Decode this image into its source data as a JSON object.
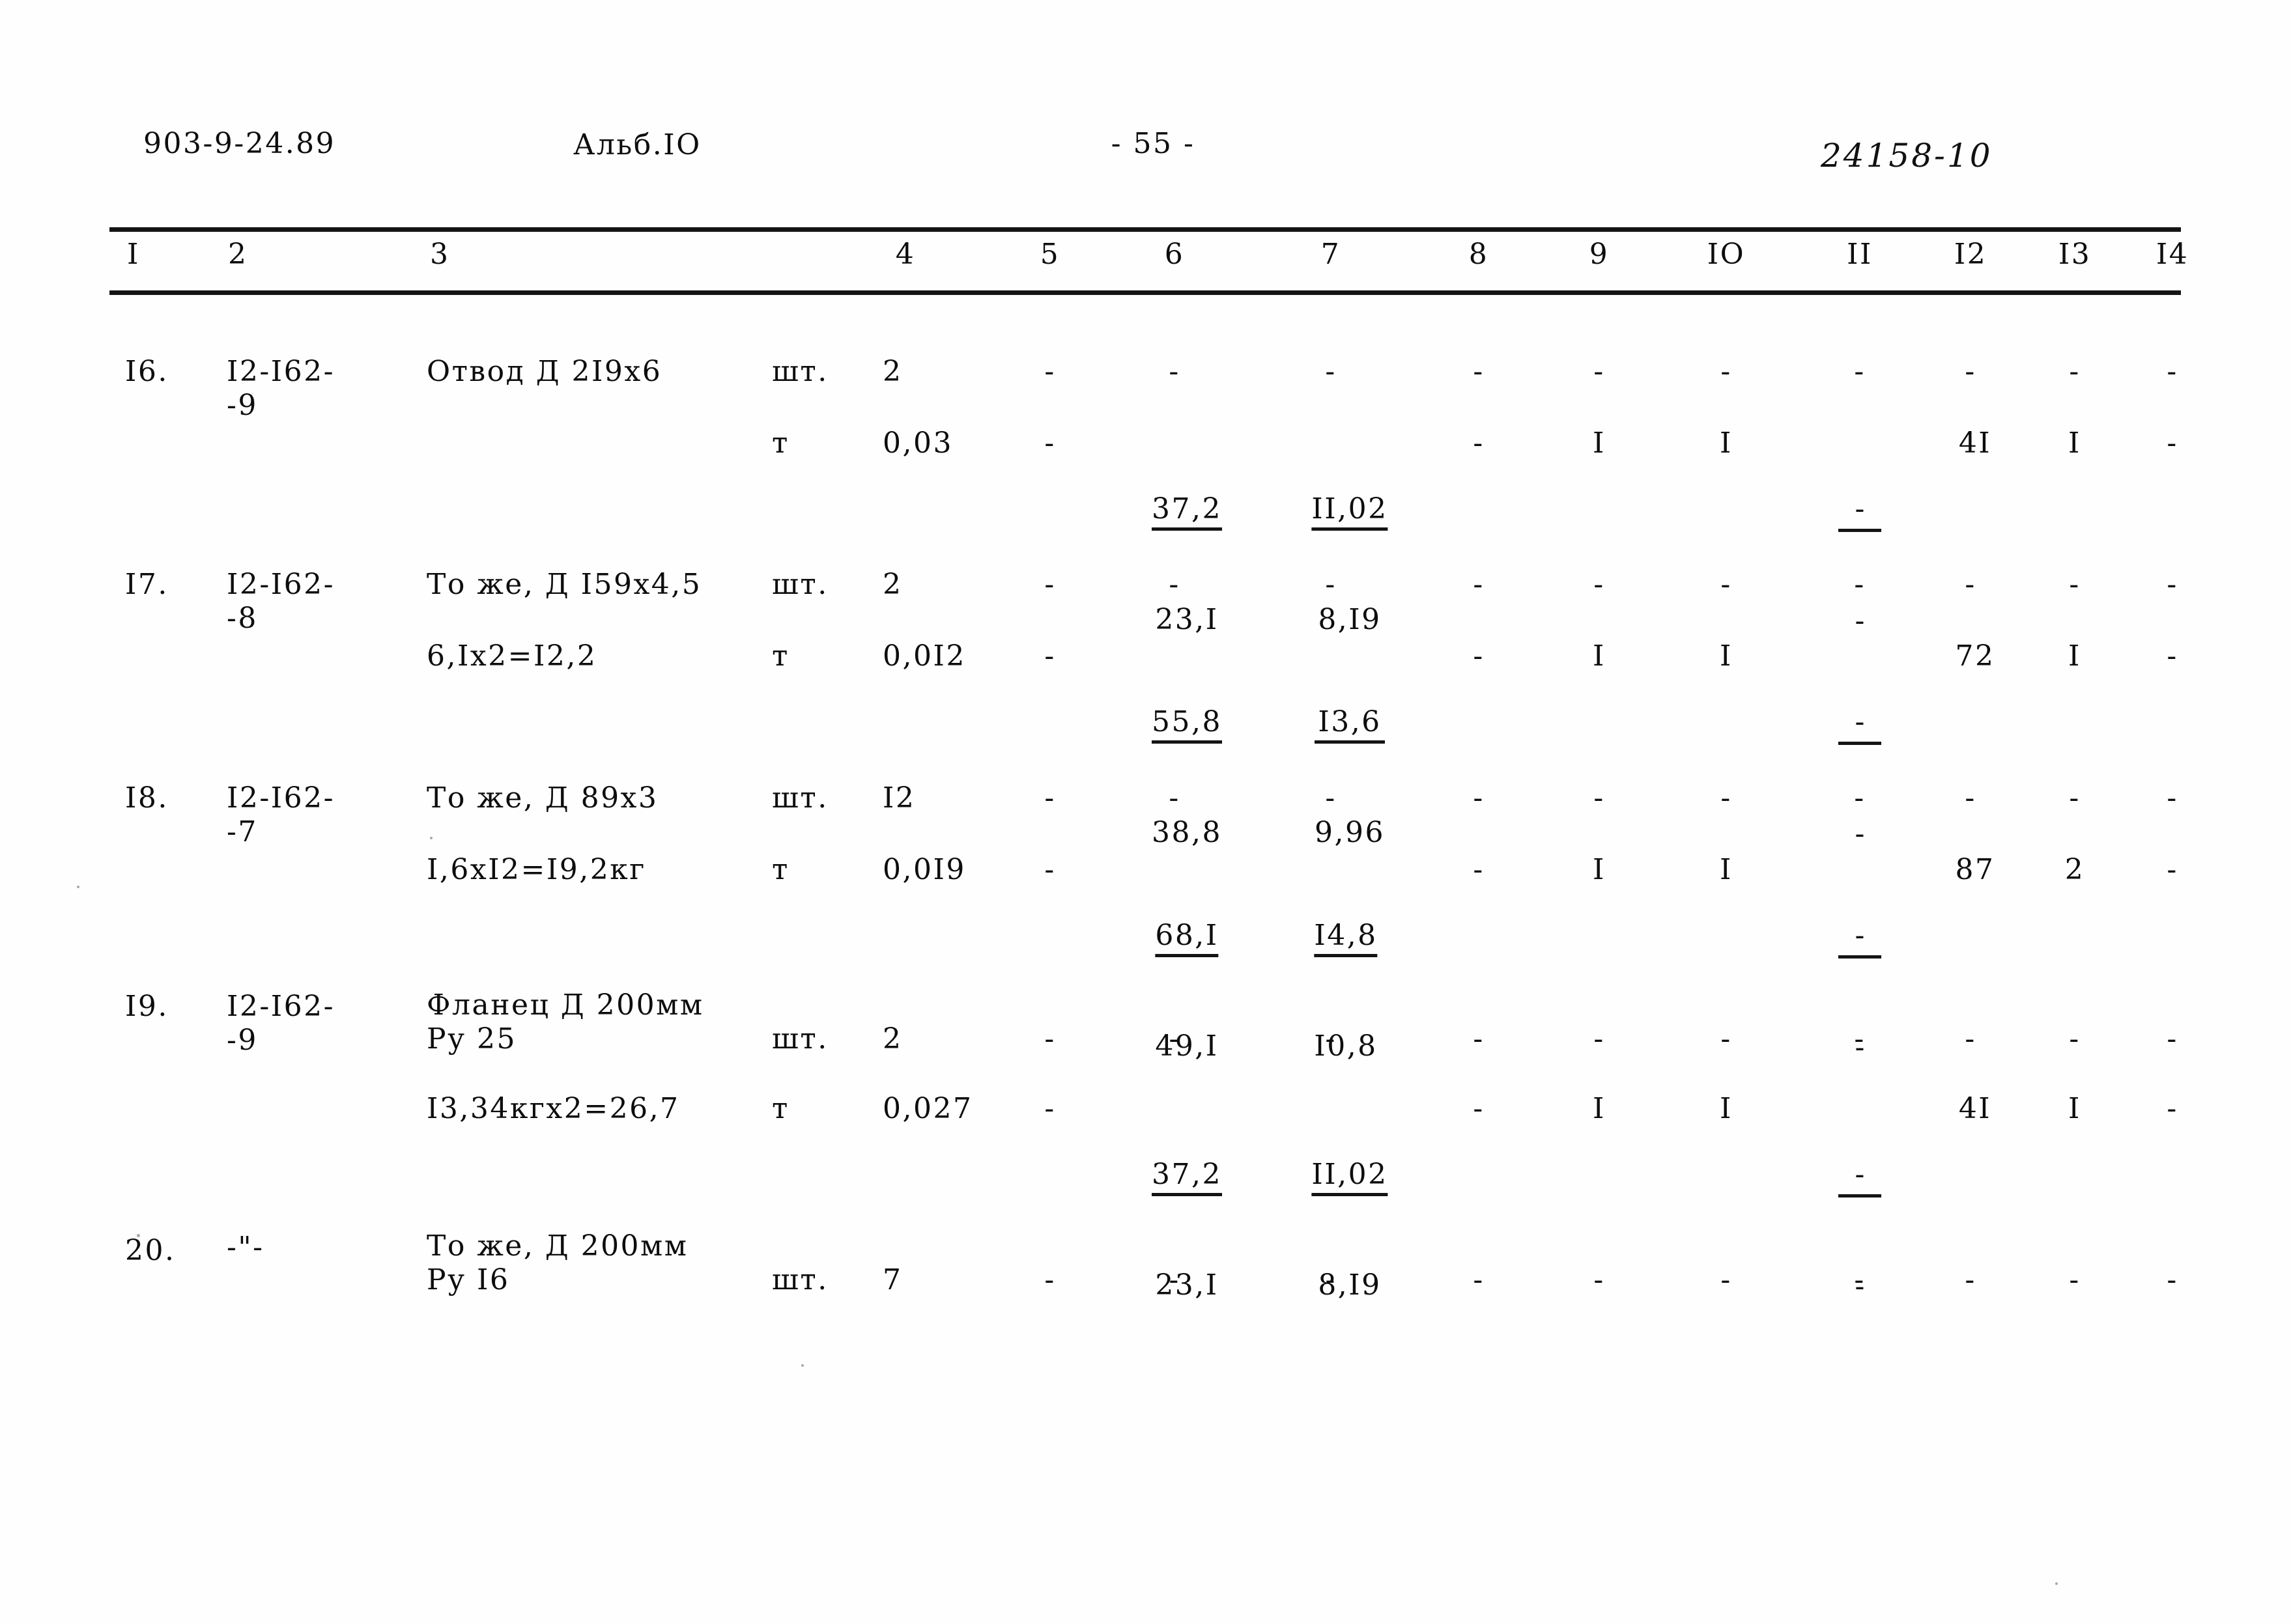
{
  "header": {
    "doc_code": "903-9-24.89",
    "album": "Альб.IO",
    "page_number": "- 55 -",
    "handwritten_mark": "24158-10"
  },
  "table": {
    "column_headers": [
      "I",
      "2",
      "3",
      "4",
      "5",
      "6",
      "7",
      "8",
      "9",
      "IO",
      "II",
      "I2",
      "I3",
      "I4"
    ],
    "rows": [
      {
        "no": "I6.",
        "code_line1": "I2-I62-",
        "code_line2": "-9",
        "name_line1": "Отвод Д 2I9х6",
        "name_line2": "",
        "unit_1": "шт.",
        "unit_2": "т",
        "qty_1": "2",
        "qty_2": "0,03",
        "c5_1": "-",
        "c5_2": "-",
        "c6_1": "-",
        "c6_num": "37,2",
        "c6_den": "23,I",
        "c7_1": "-",
        "c7_num": "II,02",
        "c7_den": "8,I9",
        "c8_1": "-",
        "c8_2": "-",
        "c9_1": "-",
        "c9_2": "I",
        "c10_1": "-",
        "c10_2": "I",
        "c11_1": "-",
        "c11_num": "-",
        "c11_den": "-",
        "c12_1": "-",
        "c12_2": "4I",
        "c13_1": "-",
        "c13_2": "I",
        "c14_1": "-",
        "c14_2": "-"
      },
      {
        "no": "I7.",
        "code_line1": "I2-I62-",
        "code_line2": "-8",
        "name_line1": "То же, Д I59х4,5",
        "name_line2": "6,Iх2=I2,2",
        "unit_1": "шт.",
        "unit_2": "т",
        "qty_1": "2",
        "qty_2": "0,0I2",
        "c5_1": "-",
        "c5_2": "-",
        "c6_1": "-",
        "c6_num": "55,8",
        "c6_den": "38,8",
        "c7_1": "-",
        "c7_num": "I3,6",
        "c7_den": "9,96",
        "c8_1": "-",
        "c8_2": "-",
        "c9_1": "-",
        "c9_2": "I",
        "c10_1": "-",
        "c10_2": "I",
        "c11_1": "-",
        "c11_num": "-",
        "c11_den": "-",
        "c12_1": "-",
        "c12_2": "72",
        "c13_1": "-",
        "c13_2": "I",
        "c14_1": "-",
        "c14_2": "-"
      },
      {
        "no": "I8.",
        "code_line1": "I2-I62-",
        "code_line2": "-7",
        "name_line1": "То же, Д 89х3",
        "name_line2": "I,6хI2=I9,2кг",
        "unit_1": "шт.",
        "unit_2": "т",
        "qty_1": "I2",
        "qty_2": "0,0I9",
        "c5_1": "-",
        "c5_2": "-",
        "c6_1": "-",
        "c6_num": "68,I",
        "c6_den": "49,I",
        "c7_1": "-",
        "c7_num": "I4,8",
        "c7_den": "I0,8",
        "c8_1": "-",
        "c8_2": "-",
        "c9_1": "-",
        "c9_2": "I",
        "c10_1": "-",
        "c10_2": "I",
        "c11_1": "-",
        "c11_num": "-",
        "c11_den": "-",
        "c12_1": "-",
        "c12_2": "87",
        "c13_1": "-",
        "c13_2": "2",
        "c14_1": "-",
        "c14_2": "-"
      },
      {
        "no": "I9.",
        "code_line1": "I2-I62-",
        "code_line2": "-9",
        "name_line1": "Фланец Д 200мм",
        "name_line1b": "Ру 25",
        "name_line2": "I3,34кгх2=26,7",
        "unit_1": "шт.",
        "unit_2": "т",
        "qty_1": "2",
        "qty_2": "0,027",
        "c5_1": "-",
        "c5_2": "-",
        "c6_1": "-",
        "c6_num": "37,2",
        "c6_den": "23,I",
        "c7_1": "-",
        "c7_num": "II,02",
        "c7_den": "8,I9",
        "c8_1": "-",
        "c8_2": "-",
        "c9_1": "-",
        "c9_2": "I",
        "c10_1": "-",
        "c10_2": "I",
        "c11_1": "-",
        "c11_num": "-",
        "c11_den": "-",
        "c12_1": "-",
        "c12_2": "4I",
        "c13_1": "-",
        "c13_2": "I",
        "c14_1": "-",
        "c14_2": "-"
      },
      {
        "no": "20.",
        "code_line1": "-\"-",
        "code_line2": "",
        "name_line1": "То же, Д 200мм",
        "name_line1b": "Ру I6",
        "name_line2": "",
        "unit_1": "шт.",
        "unit_2": "",
        "qty_1": "7",
        "qty_2": "",
        "c5_1": "-",
        "c6_1": "-",
        "c7_1": "-",
        "c8_1": "-",
        "c9_1": "-",
        "c10_1": "-",
        "c11_1": "-",
        "c12_1": "-",
        "c13_1": "-",
        "c14_1": "-"
      }
    ]
  }
}
